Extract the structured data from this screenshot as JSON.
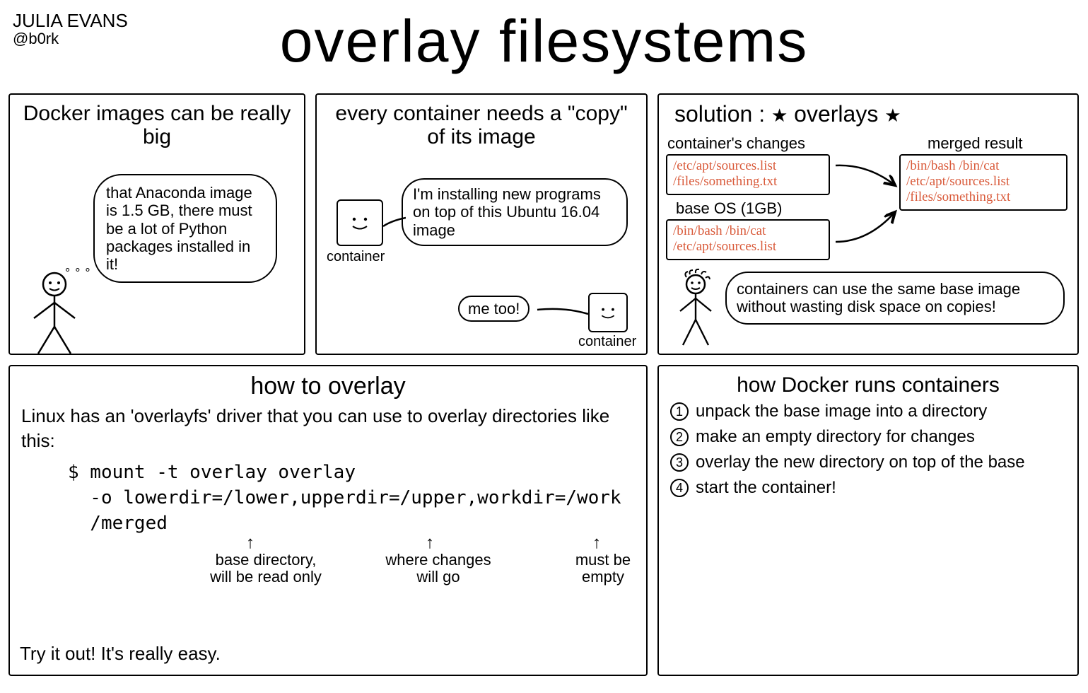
{
  "author": {
    "name": "JULIA EVANS",
    "handle": "@b0rk"
  },
  "title": "overlay filesystems",
  "panel1": {
    "title": "Docker images can be really big",
    "thought": "that Anaconda image is 1.5 GB, there must be a lot of Python packages installed in it!"
  },
  "panel2": {
    "title": "every container needs a \"copy\" of its image",
    "container_label": "container",
    "speech1": "I'm installing new programs on top of this Ubuntu 16.04 image",
    "speech2": "me too!"
  },
  "panel3": {
    "title_prefix": "solution : ",
    "title_word": "overlays",
    "changes_label": "container's changes",
    "changes_files": "/etc/apt/sources.list\n/files/something.txt",
    "base_label": "base OS (1GB)",
    "base_files": "/bin/bash /bin/cat\n/etc/apt/sources.list",
    "merged_label": "merged result",
    "merged_files": "/bin/bash /bin/cat\n/etc/apt/sources.list\n/files/something.txt",
    "note": "containers can use the same base image without wasting disk space on copies!"
  },
  "panel4": {
    "title": "how to overlay",
    "intro": "Linux has an 'overlayfs' driver that you can use to overlay directories like this:",
    "cmd_line1": "$ mount -t overlay overlay",
    "cmd_line2": "  -o lowerdir=/lower,upperdir=/upper,workdir=/work",
    "cmd_line3": "  /merged",
    "anno_lower": "base directory,\nwill be read only",
    "anno_upper": "where changes\nwill go",
    "anno_work": "must be\nempty",
    "outro": "Try it out! It's really easy."
  },
  "panel5": {
    "title": "how Docker runs containers",
    "steps": [
      "unpack the base image into a directory",
      "make an empty directory for changes",
      "overlay the new directory on top of the base",
      "start the container!"
    ]
  }
}
